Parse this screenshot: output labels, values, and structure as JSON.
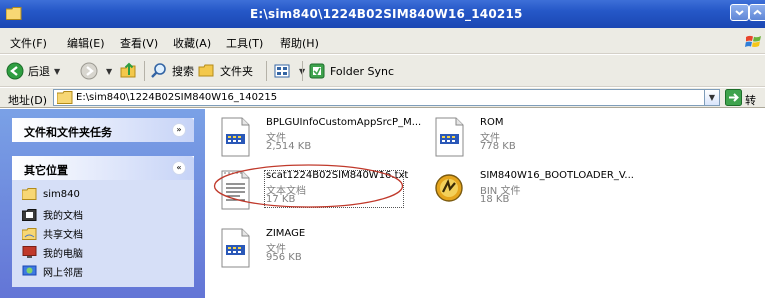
{
  "window": {
    "title": "E:\\sim840\\1224B02SIM840W16_140215"
  },
  "menubar": {
    "items": [
      "文件(F)",
      "编辑(E)",
      "查看(V)",
      "收藏(A)",
      "工具(T)",
      "帮助(H)"
    ]
  },
  "toolbar": {
    "back_label": "后退",
    "search_label": "搜索",
    "folders_label": "文件夹",
    "folder_sync_label": "Folder Sync"
  },
  "addressbar": {
    "label": "地址(D)",
    "value": "E:\\sim840\\1224B02SIM840W16_140215",
    "go_label": "转到"
  },
  "taskpane": {
    "file_tasks_title": "文件和文件夹任务",
    "other_places_title": "其它位置",
    "places": [
      "sim840",
      "我的文档",
      "共享文档",
      "我的电脑",
      "网上邻居"
    ]
  },
  "files": [
    {
      "name": "BPLGUInfoCustomAppSrcP_M...",
      "type": "文件",
      "size": "2,514 KB",
      "icon": "generic-file-icon"
    },
    {
      "name": "ROM",
      "type": "文件",
      "size": "778 KB",
      "icon": "generic-file-icon"
    },
    {
      "name": "scat1224B02SIM840W16.txt",
      "type": "文本文档",
      "size": "17 KB",
      "icon": "text-document-icon"
    },
    {
      "name": "SIM840W16_BOOTLOADER_V...",
      "type": "BIN 文件",
      "size": "18 KB",
      "icon": "bin-file-icon"
    },
    {
      "name": "ZIMAGE",
      "type": "文件",
      "size": "956 KB",
      "icon": "generic-file-icon"
    }
  ],
  "colors": {
    "titlebar": "#2557c7",
    "taskpane": "#6f8fe0",
    "highlight_ellipse": "#c0392b"
  }
}
